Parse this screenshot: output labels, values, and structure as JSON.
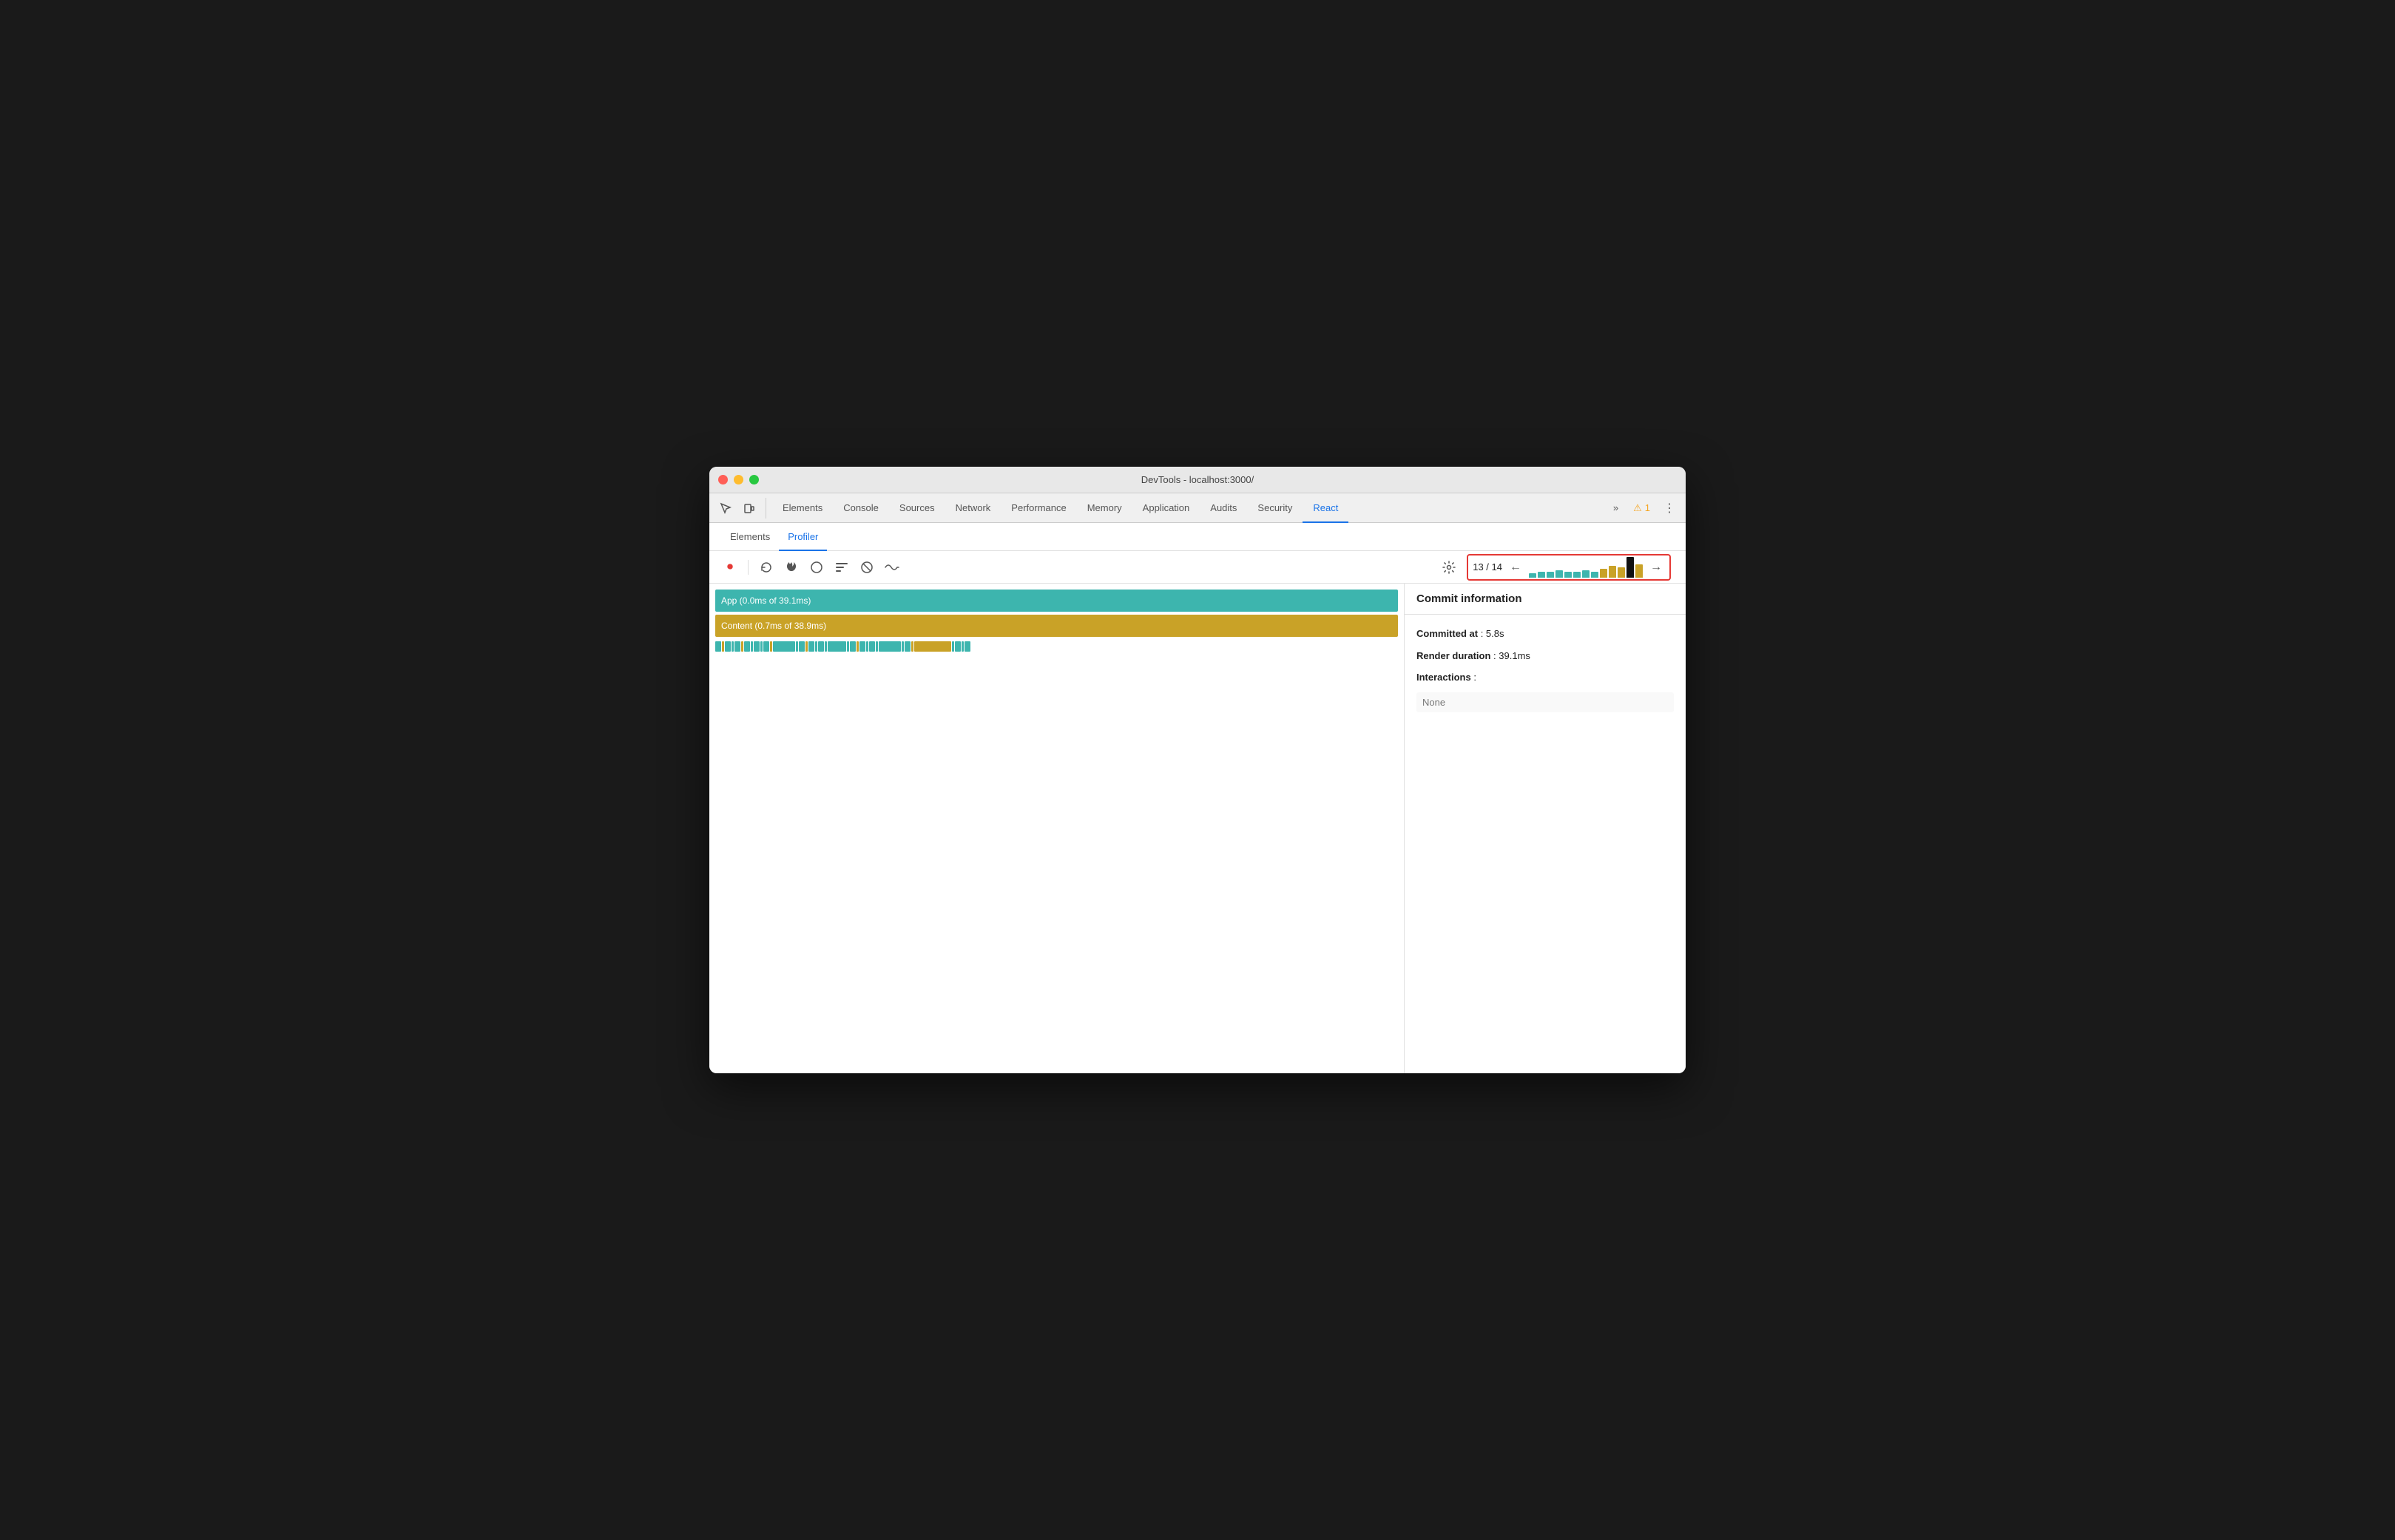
{
  "window": {
    "title": "DevTools - localhost:3000/"
  },
  "devtools_tabs": {
    "items": [
      {
        "id": "elements",
        "label": "Elements",
        "active": false
      },
      {
        "id": "console",
        "label": "Console",
        "active": false
      },
      {
        "id": "sources",
        "label": "Sources",
        "active": false
      },
      {
        "id": "network",
        "label": "Network",
        "active": false
      },
      {
        "id": "performance",
        "label": "Performance",
        "active": false
      },
      {
        "id": "memory",
        "label": "Memory",
        "active": false
      },
      {
        "id": "application",
        "label": "Application",
        "active": false
      },
      {
        "id": "audits",
        "label": "Audits",
        "active": false
      },
      {
        "id": "security",
        "label": "Security",
        "active": false
      },
      {
        "id": "react",
        "label": "React",
        "active": true
      }
    ],
    "overflow_label": "»",
    "warning_count": "1",
    "more_label": "⋮"
  },
  "sub_tabs": [
    {
      "id": "elements",
      "label": "Elements",
      "active": false
    },
    {
      "id": "profiler",
      "label": "Profiler",
      "active": true
    }
  ],
  "profiler_toolbar": {
    "record_label": "⏺",
    "reload_record_label": "🔄",
    "flame_label": "🔥",
    "stop_label": "◯",
    "ranked_label": "≡",
    "exclude_label": "◯",
    "timeline_label": "〰",
    "settings_label": "⚙",
    "commit_counter": "13 / 14",
    "prev_label": "←",
    "next_label": "→"
  },
  "commit_bars": [
    {
      "height": 6,
      "color": "#3db5ae"
    },
    {
      "height": 8,
      "color": "#3db5ae"
    },
    {
      "height": 8,
      "color": "#3db5ae"
    },
    {
      "height": 10,
      "color": "#3db5ae"
    },
    {
      "height": 8,
      "color": "#3db5ae"
    },
    {
      "height": 8,
      "color": "#3db5ae"
    },
    {
      "height": 10,
      "color": "#3db5ae"
    },
    {
      "height": 8,
      "color": "#3db5ae"
    },
    {
      "height": 12,
      "color": "#c9a227"
    },
    {
      "height": 16,
      "color": "#c9a227"
    },
    {
      "height": 14,
      "color": "#c9a227"
    },
    {
      "height": 28,
      "color": "#111"
    },
    {
      "height": 18,
      "color": "#c9a227"
    }
  ],
  "flame_chart": {
    "app_row": {
      "label": "App (0.0ms of 39.1ms)",
      "color": "#3db5ae"
    },
    "content_row": {
      "label": "Content (0.7ms of 38.9ms)",
      "color": "#c9a227"
    }
  },
  "mini_blocks": [
    {
      "width": 8,
      "color": "#3db5ae"
    },
    {
      "width": 3,
      "color": "#c9a227"
    },
    {
      "width": 8,
      "color": "#3db5ae"
    },
    {
      "width": 3,
      "color": "#3db5ae"
    },
    {
      "width": 8,
      "color": "#3db5ae"
    },
    {
      "width": 3,
      "color": "#c9a227"
    },
    {
      "width": 8,
      "color": "#3db5ae"
    },
    {
      "width": 3,
      "color": "#3db5ae"
    },
    {
      "width": 8,
      "color": "#3db5ae"
    },
    {
      "width": 3,
      "color": "#3db5ae"
    },
    {
      "width": 8,
      "color": "#3db5ae"
    },
    {
      "width": 3,
      "color": "#c9a227"
    },
    {
      "width": 30,
      "color": "#3db5ae"
    },
    {
      "width": 3,
      "color": "#3db5ae"
    },
    {
      "width": 8,
      "color": "#3db5ae"
    },
    {
      "width": 3,
      "color": "#c9a227"
    },
    {
      "width": 8,
      "color": "#3db5ae"
    },
    {
      "width": 3,
      "color": "#3db5ae"
    },
    {
      "width": 8,
      "color": "#3db5ae"
    },
    {
      "width": 3,
      "color": "#3db5ae"
    },
    {
      "width": 25,
      "color": "#3db5ae"
    },
    {
      "width": 3,
      "color": "#3db5ae"
    },
    {
      "width": 8,
      "color": "#3db5ae"
    },
    {
      "width": 3,
      "color": "#c9a227"
    },
    {
      "width": 8,
      "color": "#3db5ae"
    },
    {
      "width": 3,
      "color": "#3db5ae"
    },
    {
      "width": 8,
      "color": "#3db5ae"
    },
    {
      "width": 3,
      "color": "#3db5ae"
    },
    {
      "width": 30,
      "color": "#3db5ae"
    },
    {
      "width": 3,
      "color": "#3db5ae"
    },
    {
      "width": 8,
      "color": "#3db5ae"
    },
    {
      "width": 3,
      "color": "#c9a227"
    },
    {
      "width": 50,
      "color": "#c9a227"
    },
    {
      "width": 3,
      "color": "#3db5ae"
    },
    {
      "width": 8,
      "color": "#3db5ae"
    },
    {
      "width": 3,
      "color": "#3db5ae"
    },
    {
      "width": 8,
      "color": "#3db5ae"
    }
  ],
  "commit_info": {
    "header": "Commit information",
    "committed_at_label": "Committed at",
    "committed_at_value": "5.8s",
    "render_duration_label": "Render duration",
    "render_duration_value": "39.1ms",
    "interactions_label": "Interactions",
    "interactions_value": "None"
  }
}
